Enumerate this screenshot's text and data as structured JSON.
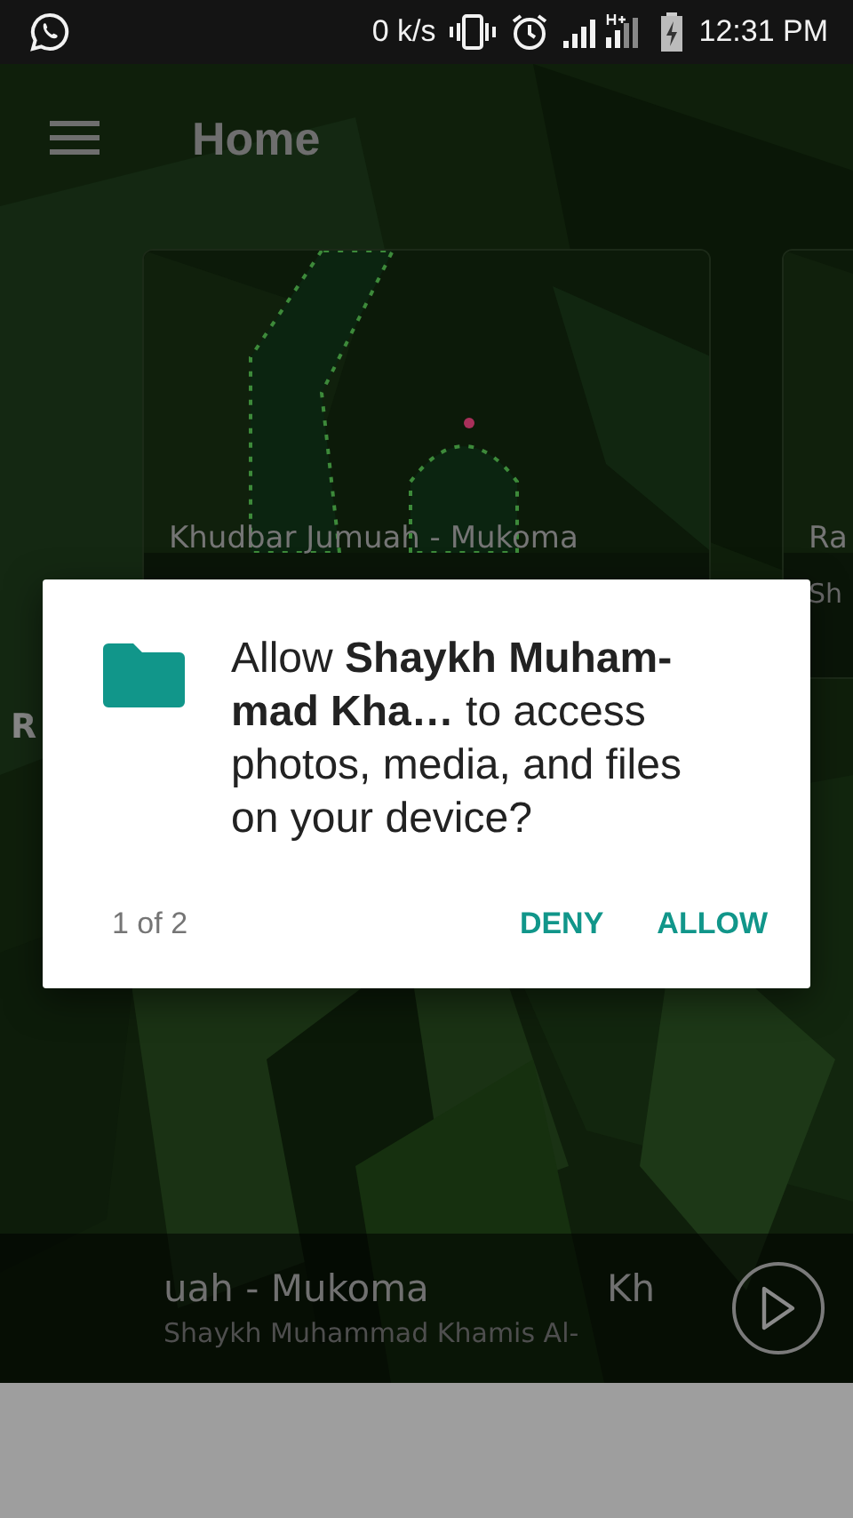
{
  "status_bar": {
    "speed": "0 k/s",
    "time": "12:31 PM"
  },
  "toolbar": {
    "title": "Home"
  },
  "cards": [
    {
      "title": "Khudbar Jumuah - Mukoma"
    },
    {
      "title": "Ra",
      "subtitle": "Sh"
    }
  ],
  "section": {
    "heading": "R"
  },
  "player": {
    "title": "uah - Mukoma",
    "artist": "Shaykh Muhammad Khamis Al-",
    "next_title": "Kh"
  },
  "dialog": {
    "message": "Allow **Shaykh Muham-mad Kha…** to access photos, media, and files on your device?",
    "counter": "1 of 2",
    "buttons": [
      "DENY",
      "ALLOW"
    ]
  }
}
